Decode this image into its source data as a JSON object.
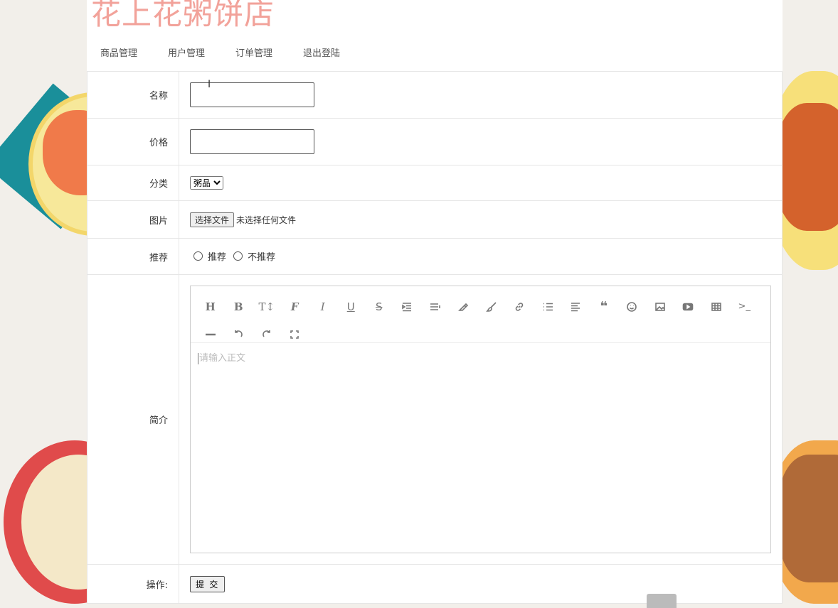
{
  "shop": {
    "title": "花上花粥饼店"
  },
  "nav": {
    "items": [
      "商品管理",
      "用户管理",
      "订单管理",
      "退出登陆"
    ]
  },
  "form": {
    "name_label": "名称",
    "price_label": "价格",
    "category_label": "分类",
    "category_selected": "粥品",
    "image_label": "图片",
    "file_button": "选择文件",
    "file_status": "未选择任何文件",
    "recommend_label": "推荐",
    "recommend_options": [
      "推荐",
      "不推荐"
    ],
    "intro_label": "简介",
    "editor_placeholder": "请输入正文",
    "action_label": "操作:",
    "submit_label": "提 交"
  },
  "editor": {
    "toolbar_icons": [
      "heading-icon",
      "bold-icon",
      "font-size-icon",
      "font-family-icon",
      "italic-icon",
      "underline-icon",
      "strikethrough-icon",
      "indent-icon",
      "line-height-icon",
      "text-color-icon",
      "background-color-icon",
      "link-icon",
      "unordered-list-icon",
      "align-icon",
      "quote-icon",
      "emoji-icon",
      "image-icon",
      "video-icon",
      "table-icon",
      "code-icon",
      "divider-icon",
      "undo-icon",
      "redo-icon",
      "fullscreen-icon"
    ]
  },
  "colors": {
    "title": "#f2a29a",
    "panel_bg": "#ffffff",
    "page_bg": "#f2efea"
  }
}
